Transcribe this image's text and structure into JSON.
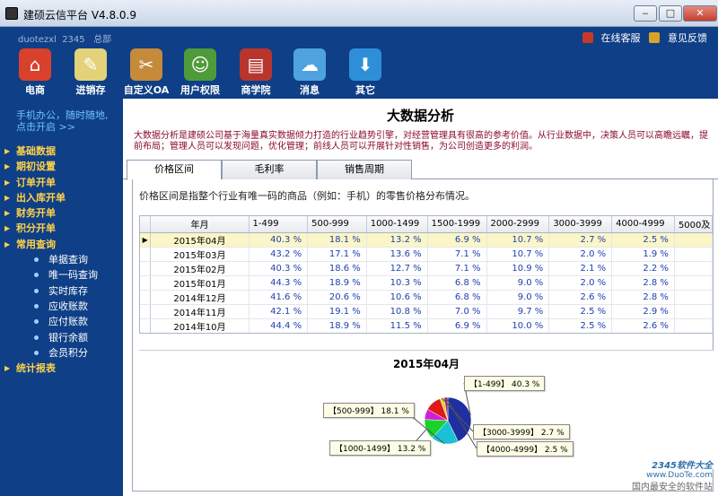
{
  "window": {
    "title": "建硕云信平台  V4.8.0.9",
    "min": "‒",
    "max": "□",
    "close": "✕"
  },
  "user": {
    "name": "duotezxl",
    "id": "2345",
    "branch": "总部"
  },
  "top_links": [
    {
      "label": "在线客服",
      "color": "#c43a2a"
    },
    {
      "label": "意见反馈",
      "color": "#d9a22a"
    }
  ],
  "nav": [
    {
      "label": "电商",
      "icon": "house-icon",
      "glyph": "⌂",
      "bg": "#d9412c"
    },
    {
      "label": "进销存",
      "icon": "notebook-icon",
      "glyph": "✎",
      "bg": "#e3d27a"
    },
    {
      "label": "自定义OA",
      "icon": "tools-icon",
      "glyph": "✂",
      "bg": "#c58a3a"
    },
    {
      "label": "用户权限",
      "icon": "users-icon",
      "glyph": "☺",
      "bg": "#4f9a3a"
    },
    {
      "label": "商学院",
      "icon": "book-icon",
      "glyph": "▤",
      "bg": "#b8352e"
    },
    {
      "label": "消息",
      "icon": "chat-icon",
      "glyph": "☁",
      "bg": "#4ea3df"
    },
    {
      "label": "其它",
      "icon": "download-icon",
      "glyph": "⬇",
      "bg": "#2e8fd8"
    }
  ],
  "sidebar": {
    "slogan_line1": "手机办公，随时随地,",
    "slogan_line2": "点击开启 >>",
    "menu": [
      "基础数据",
      "期初设置",
      "订单开单",
      "出入库开单",
      "财务开单",
      "积分开单",
      "常用查询"
    ],
    "sub": [
      "单据查询",
      "唯一码查询",
      "实时库存",
      "应收账款",
      "应付账款",
      "银行余额",
      "会员积分"
    ],
    "last": "统计报表"
  },
  "main": {
    "title": "大数据分析",
    "desc": "大数据分析是建硕公司基于海量真实数据倾力打造的行业趋势引擎，对经营管理具有很高的参考价值。从行业数据中，决策人员可以高瞻远瞩，提前布局；管理人员可以发现问题，优化管理；前线人员可以开展针对性销售，为公司创造更多的利润。",
    "tabs": [
      "价格区间",
      "毛利率",
      "销售周期"
    ],
    "note": "价格区间是指整个行业有唯一码的商品（例如：手机）的零售价格分布情况。"
  },
  "grid": {
    "columns": [
      "年月",
      "1-499",
      "500-999",
      "1000-1499",
      "1500-1999",
      "2000-2999",
      "3000-3999",
      "4000-4999",
      "5000及"
    ],
    "rows": [
      [
        "2015年04月",
        "40.3 %",
        "18.1 %",
        "13.2 %",
        "6.9 %",
        "10.7 %",
        "2.7 %",
        "2.5 %",
        ""
      ],
      [
        "2015年03月",
        "43.2 %",
        "17.1 %",
        "13.6 %",
        "7.1 %",
        "10.7 %",
        "2.0 %",
        "1.9 %",
        ""
      ],
      [
        "2015年02月",
        "40.3 %",
        "18.6 %",
        "12.7 %",
        "7.1 %",
        "10.9 %",
        "2.1 %",
        "2.2 %",
        ""
      ],
      [
        "2015年01月",
        "44.3 %",
        "18.9 %",
        "10.3 %",
        "6.8 %",
        "9.0 %",
        "2.0 %",
        "2.8 %",
        ""
      ],
      [
        "2014年12月",
        "41.6 %",
        "20.6 %",
        "10.6 %",
        "6.8 %",
        "9.0 %",
        "2.6 %",
        "2.8 %",
        ""
      ],
      [
        "2014年11月",
        "42.1 %",
        "19.1 %",
        "10.8 %",
        "7.0 %",
        "9.7 %",
        "2.5 %",
        "2.9 %",
        ""
      ],
      [
        "2014年10月",
        "44.4 %",
        "18.9 %",
        "11.5 %",
        "6.9 %",
        "10.0 %",
        "2.5 %",
        "2.6 %",
        ""
      ]
    ],
    "selected_indicator": "▶"
  },
  "chart_data": {
    "type": "pie",
    "title": "2015年04月",
    "slices": [
      {
        "label": "【1-499】 40.3 %",
        "category": "1-499",
        "value": 40.3,
        "color": "#1f2fa0"
      },
      {
        "label": "【500-999】 18.1 %",
        "category": "500-999",
        "value": 18.1,
        "color": "#19c1d6"
      },
      {
        "label": "【1000-1499】 13.2 %",
        "category": "1000-1499",
        "value": 13.2,
        "color": "#1bd12c"
      },
      {
        "label": "",
        "category": "1500-1999",
        "value": 6.9,
        "color": "#d11dd6"
      },
      {
        "label": "",
        "category": "2000-2999",
        "value": 10.7,
        "color": "#e01818"
      },
      {
        "label": "【3000-3999】 2.7 %",
        "category": "3000-3999",
        "value": 2.7,
        "color": "#e0d51b"
      },
      {
        "label": "【4000-4999】 2.5 %",
        "category": "4000-4999",
        "value": 2.5,
        "color": "#8f2a8f"
      }
    ]
  },
  "watermark": {
    "line1": "2345软件大全",
    "line2": "www.DuoTe.com",
    "line3": "国内最安全的软件站"
  }
}
